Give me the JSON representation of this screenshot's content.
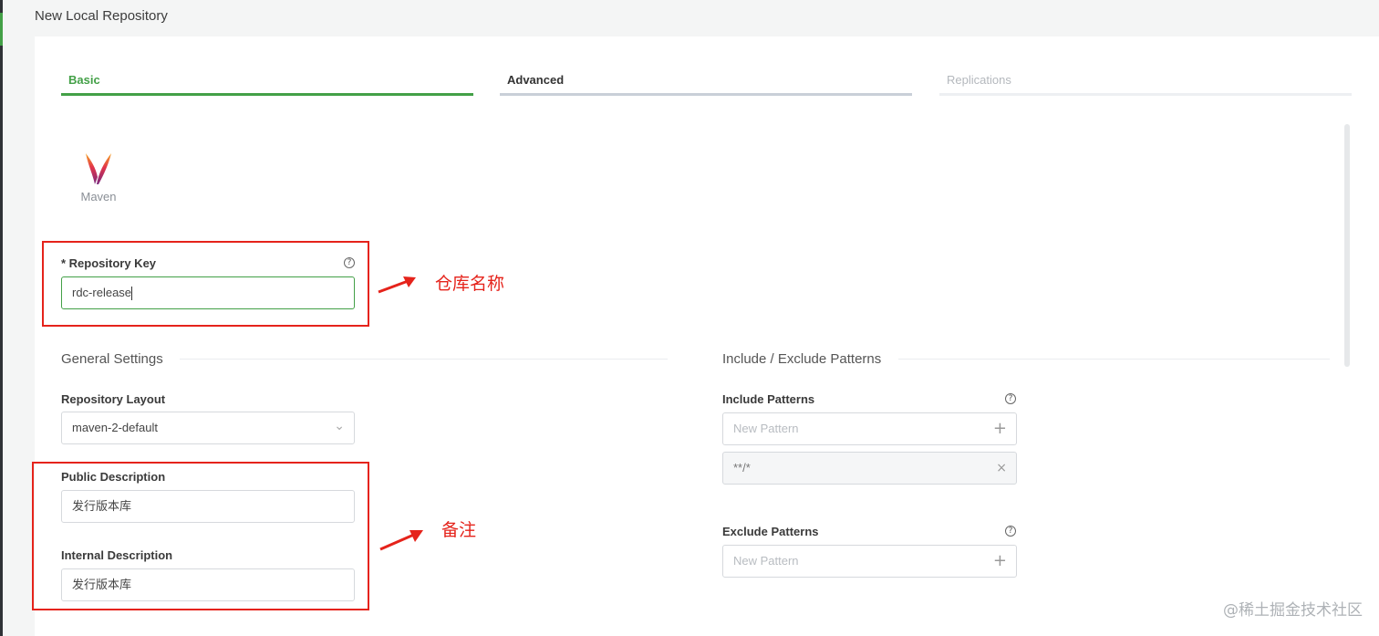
{
  "page": {
    "title": "New Local Repository"
  },
  "tabs": [
    {
      "label": "Basic",
      "state": "active"
    },
    {
      "label": "Advanced",
      "state": "normal"
    },
    {
      "label": "Replications",
      "state": "disabled"
    }
  ],
  "package_type": {
    "label": "Maven",
    "icon": "maven-feather-icon"
  },
  "repository_key": {
    "label": "* Repository Key",
    "value": "rdc-release",
    "help_icon": "?"
  },
  "general_settings": {
    "title": "General Settings",
    "layout_label": "Repository Layout",
    "layout_value": "maven-2-default",
    "public_description_label": "Public Description",
    "public_description_value": "发行版本库",
    "internal_description_label": "Internal Description",
    "internal_description_value": "发行版本库"
  },
  "patterns": {
    "title": "Include / Exclude Patterns",
    "include_label": "Include Patterns",
    "include_placeholder": "New Pattern",
    "include_items": [
      "**/*"
    ],
    "exclude_label": "Exclude Patterns",
    "exclude_placeholder": "New Pattern"
  },
  "annotations": {
    "repo_name_note": "仓库名称",
    "remark_note": "备注"
  },
  "watermark": "@稀土掘金技术社区",
  "colors": {
    "accent": "#43a047",
    "annotation": "#e5231b"
  },
  "icons": {
    "add": "+",
    "remove": "×",
    "chevron": "⌄"
  }
}
